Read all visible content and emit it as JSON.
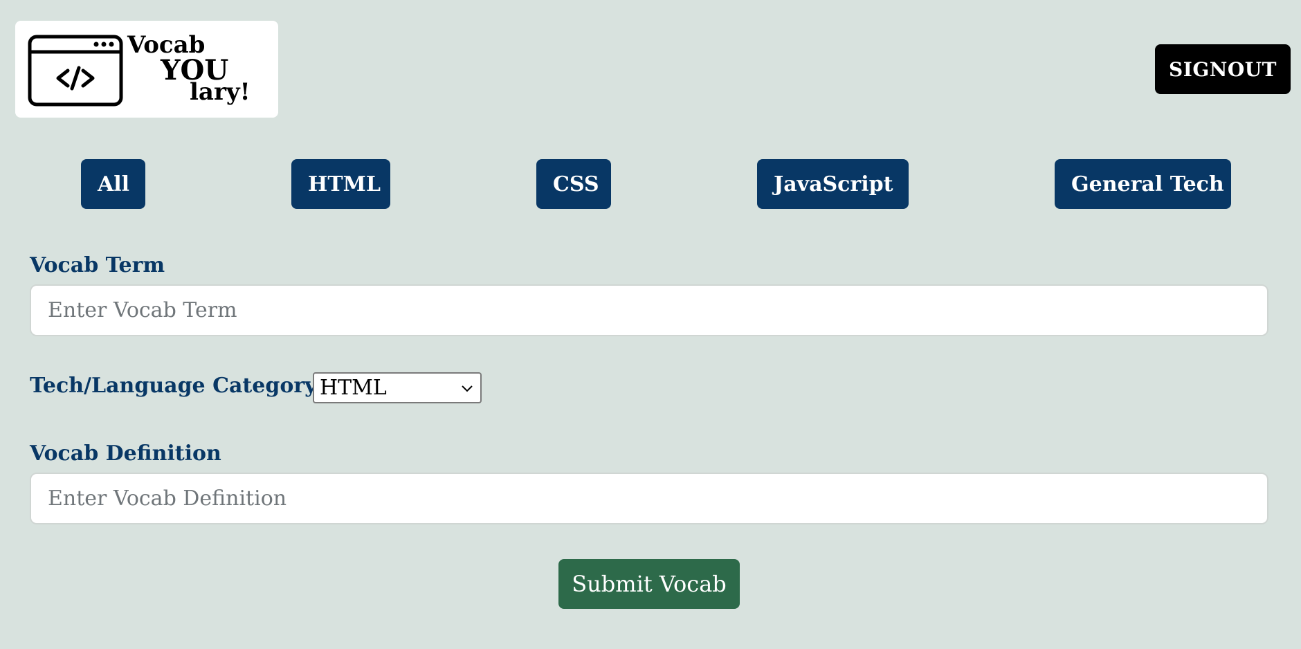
{
  "header": {
    "logo": {
      "line1": "Vocab",
      "line2": "YOU",
      "line3": "lary!",
      "icon": "code-browser-icon"
    },
    "signout_label": "SIGNOUT"
  },
  "categories": [
    {
      "label": "All"
    },
    {
      "label": "HTML"
    },
    {
      "label": "CSS"
    },
    {
      "label": "JavaScript"
    },
    {
      "label": "General Tech"
    }
  ],
  "form": {
    "term_label": "Vocab Term",
    "term_placeholder": "Enter Vocab Term",
    "term_value": "",
    "category_label": "Tech/Language Category",
    "category_selected": "HTML",
    "definition_label": "Vocab Definition",
    "definition_placeholder": "Enter Vocab Definition",
    "definition_value": "",
    "submit_label": "Submit Vocab"
  },
  "colors": {
    "background": "#d8e2de",
    "primary": "#083765",
    "submit": "#2d6a4a",
    "signout": "#000000"
  }
}
